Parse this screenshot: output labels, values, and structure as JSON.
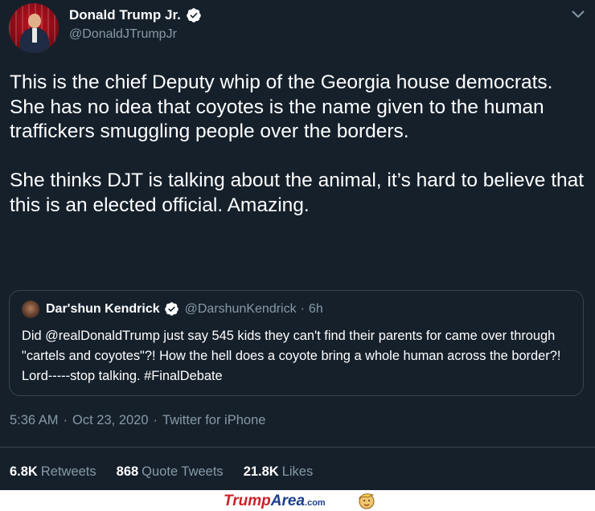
{
  "author": {
    "name": "Donald Trump Jr.",
    "handle": "@DonaldJTrumpJr",
    "verified": true
  },
  "tweet": {
    "paragraphs": [
      "This is the chief Deputy whip of the Georgia house democrats. She has no idea that coyotes is the name given to the human traffickers smuggling people over the borders.",
      "She thinks DJT is talking about the animal, it’s hard to believe that this is an elected official. Amazing."
    ]
  },
  "quoted": {
    "name": "Dar'shun Kendrick",
    "handle": "@DarshunKendrick",
    "separator": "·",
    "time": "6h",
    "text": "Did @realDonaldTrump just say 545 kids they can't find their parents for came over through \"cartels and coyotes\"?! How the hell does a coyote bring a whole human across the border?!  Lord-----stop talking. #FinalDebate"
  },
  "meta": {
    "time": "5:36 AM",
    "separator": "·",
    "date": "Oct 23, 2020",
    "source": "Twitter for iPhone"
  },
  "stats": [
    {
      "value": "6.8K",
      "label": "Retweets"
    },
    {
      "value": "868",
      "label": "Quote Tweets"
    },
    {
      "value": "21.8K",
      "label": "Likes"
    }
  ],
  "watermark": {
    "part1": "Trump",
    "part2": "Area",
    "part3": ".com"
  },
  "colors": {
    "background": "#15202b",
    "text_primary": "#ffffff",
    "text_secondary": "#8899a6",
    "verified_badge": "#ffffff",
    "border": "#38444d",
    "watermark_red": "#cc2128",
    "watermark_blue": "#1c3f8a"
  },
  "icons": [
    "verified-badge-icon",
    "chevron-down-icon",
    "trump-mascot-icon"
  ]
}
